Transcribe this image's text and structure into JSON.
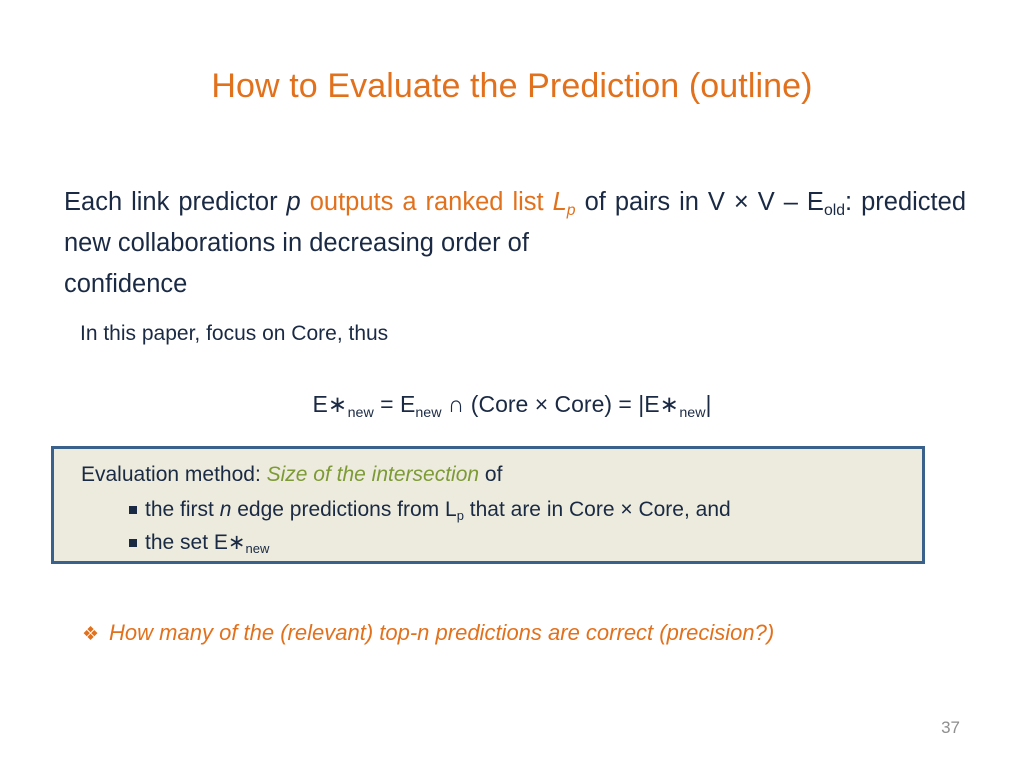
{
  "slide": {
    "title": "How to Evaluate the Prediction (outline)",
    "page_number": "37",
    "colors": {
      "accent_orange": "#E2711D",
      "body_navy": "#1b2a44",
      "box_border": "#39618c",
      "box_fill": "#ecebdd",
      "green_italic": "#7d9a36",
      "page_number_gray": "#8e8e8e"
    }
  },
  "lead_paragraph": {
    "seg_1": "Each link predictor ",
    "seg_2_italic": "p",
    "seg_3_orange": " outputs a ranked list ",
    "seg_4_orange_italic": "L",
    "seg_4_sub": "p",
    "seg_5": " of pairs in V × V – E",
    "seg_5_sub": "old",
    "seg_6": ": predicted new collaborations in decreasing order of",
    "seg_7_last_line": "confidence"
  },
  "sub_line": {
    "text": "In this paper, focus on Core, thus"
  },
  "formula": {
    "lhs_base": "E",
    "lhs_star": "∗",
    "lhs_sub": "new",
    "eq_1": " =  E",
    "mid_sub": "new",
    "intersect": " ∩ (Core × Core)  = |E",
    "rhs_star": "∗",
    "rhs_sub": "new",
    "close": "|"
  },
  "eval_box": {
    "label": "Evaluation method: ",
    "emphasis": "Size of the intersection",
    "label_tail": " of",
    "bullets": [
      {
        "pre": "the first ",
        "italic": "n",
        "mid": " edge predictions from L",
        "sub": "p",
        "post": " that are in Core × Core, and"
      },
      {
        "pre": "the set E",
        "italic": "∗",
        "mid": "",
        "sub": "new",
        "post": ""
      }
    ]
  },
  "bottom_note": {
    "bullet_glyph": "❖",
    "text": "How many of the (relevant) top-n predictions are correct (precision?)"
  }
}
